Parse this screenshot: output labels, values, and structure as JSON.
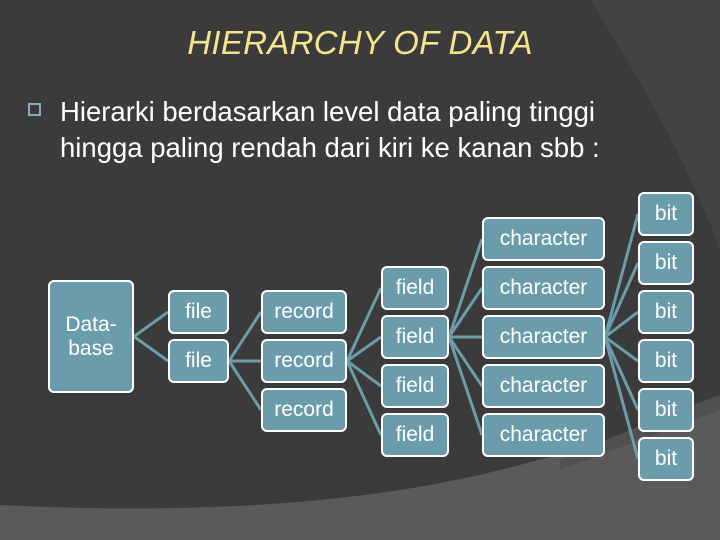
{
  "slide": {
    "title": "HIERARCHY OF DATA",
    "bullet_icon": "square-bullet-icon",
    "bullet_text": "Hierarki berdasarkan level data paling tinggi hingga paling rendah dari kiri ke kanan sbb :"
  },
  "colors": {
    "background": "#3b3b3b",
    "title": "#f4e58c",
    "node_fill": "#6b9cab",
    "node_border": "#ffffff",
    "connector": "#6b9cab"
  },
  "diagram": {
    "levels": [
      {
        "name": "database",
        "nodes": [
          "Data-\nbase"
        ]
      },
      {
        "name": "file",
        "nodes": [
          "file",
          "file"
        ]
      },
      {
        "name": "record",
        "nodes": [
          "record",
          "record",
          "record"
        ]
      },
      {
        "name": "field",
        "nodes": [
          "field",
          "field",
          "field",
          "field"
        ]
      },
      {
        "name": "character",
        "nodes": [
          "character",
          "character",
          "character",
          "character",
          "character"
        ]
      },
      {
        "name": "bit",
        "nodes": [
          "bit",
          "bit",
          "bit",
          "bit",
          "bit",
          "bit"
        ]
      }
    ],
    "expanded_parent_index": [
      0,
      1,
      1,
      1,
      2
    ]
  }
}
